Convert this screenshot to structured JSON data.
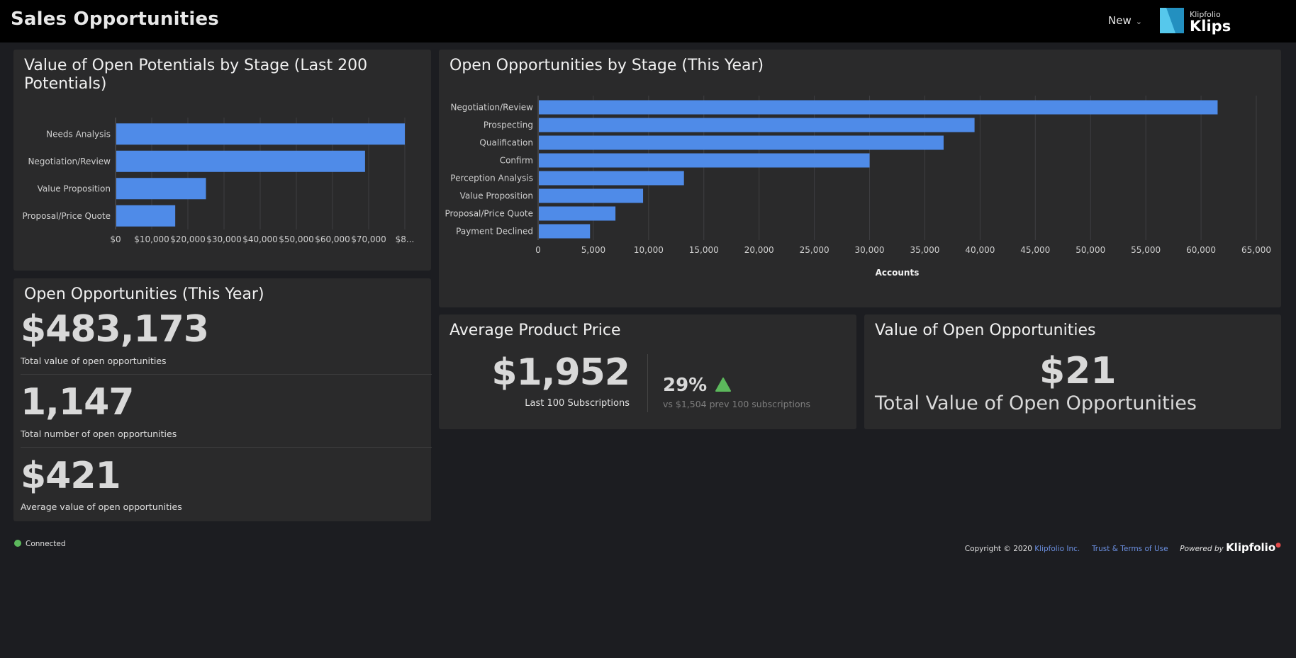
{
  "header": {
    "title": "Sales Opportunities",
    "new_label": "New",
    "brand_small": "Klipfolio",
    "brand_large": "Klips"
  },
  "colors": {
    "bar": "#4f8be8",
    "accent_green": "#5cb85c",
    "link": "#6b8fe0"
  },
  "potentials_card": {
    "title_line1": "Value of Open Potentials by Stage (Last 200",
    "title_line2": "Potentials)"
  },
  "opps_card": {
    "title": "Open Opportunities by Stage (This Year)"
  },
  "chart_data": [
    {
      "type": "bar",
      "orientation": "horizontal",
      "title": "Value of Open Potentials by Stage (Last 200 Potentials)",
      "categories": [
        "Needs Analysis",
        "Negotiation/Review",
        "Value Proposition",
        "Proposal/Price Quote"
      ],
      "values": [
        80000,
        69000,
        25000,
        16500
      ],
      "x_ticks": [
        "$0",
        "$10,000",
        "$20,000",
        "$30,000",
        "$40,000",
        "$50,000",
        "$60,000",
        "$70,000",
        "$8..."
      ],
      "xlim": [
        0,
        80000
      ],
      "grid": true
    },
    {
      "type": "bar",
      "orientation": "horizontal",
      "title": "Open Opportunities by Stage (This Year)",
      "categories": [
        "Negotiation/Review",
        "Prospecting",
        "Qualification",
        "Confirm",
        "Perception Analysis",
        "Value Proposition",
        "Proposal/Price Quote",
        "Payment Declined"
      ],
      "values": [
        61500,
        39500,
        36700,
        30000,
        13200,
        9500,
        7000,
        4700
      ],
      "x_ticks": [
        "0",
        "5,000",
        "10,000",
        "15,000",
        "20,000",
        "25,000",
        "30,000",
        "35,000",
        "40,000",
        "45,000",
        "50,000",
        "55,000",
        "60,000",
        "65,000"
      ],
      "xlim": [
        0,
        65000
      ],
      "xlabel": "Accounts",
      "grid": true
    }
  ],
  "open_opps": {
    "title": "Open Opportunities (This Year)",
    "metrics": [
      {
        "value": "$483,173",
        "label": "Total value of open opportunities"
      },
      {
        "value": "1,147",
        "label": "Total number of open opportunities"
      },
      {
        "value": "$421",
        "label": "Average value of open opportunities"
      }
    ]
  },
  "avg_price": {
    "title": "Average Product Price",
    "value": "$1,952",
    "sub": "Last 100 Subscriptions",
    "change": "29%",
    "trend_icon": "triangle-up",
    "compare": "vs $1,504 prev 100 subscriptions"
  },
  "value_open": {
    "title": "Value of Open Opportunities",
    "value": "$21",
    "label": "Total Value of Open Opportunities"
  },
  "footer": {
    "status": "Connected",
    "copyright": "Copyright © 2020",
    "company_link": "Klipfolio Inc.",
    "terms_link": "Trust & Terms of Use",
    "powered": "Powered by",
    "powered_brand": "Klipfolio"
  }
}
